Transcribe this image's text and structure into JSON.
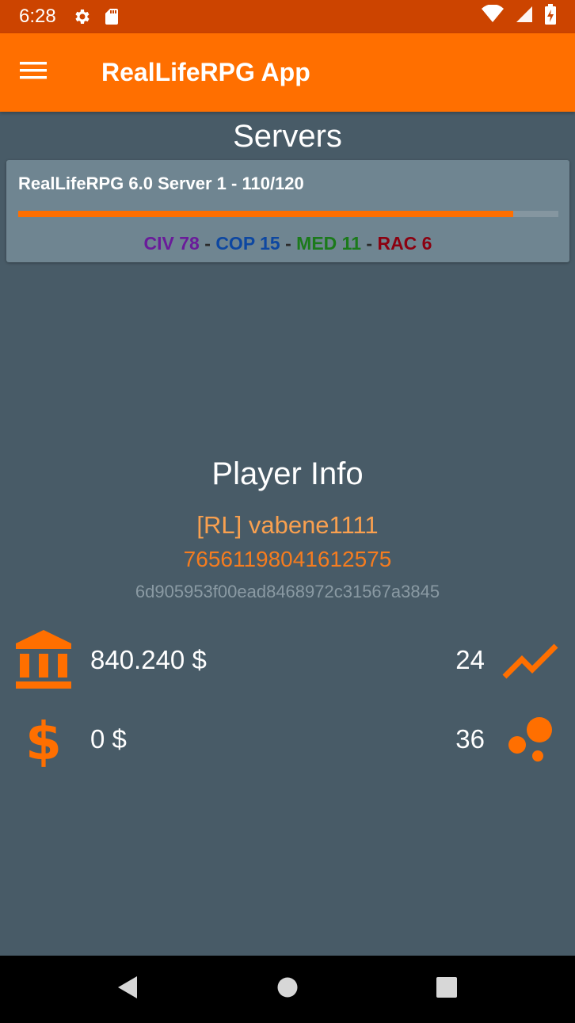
{
  "status_bar": {
    "time": "6:28",
    "icons": [
      "gear-icon",
      "sd-card-icon",
      "wifi-icon",
      "signal-icon",
      "battery-charging-icon"
    ]
  },
  "app_bar": {
    "title": "RealLifeRPG App",
    "menu_icon": "hamburger-menu-icon"
  },
  "servers": {
    "heading": "Servers",
    "items": [
      {
        "name": "RealLifeRPG 6.0 Server 1 - 110/120",
        "players": 110,
        "max_players": 120,
        "fill_fraction": 0.9167,
        "factions": {
          "civ": "CIV 78",
          "cop": "COP 15",
          "med": "MED 11",
          "rac": "RAC 6",
          "separator": " - "
        }
      }
    ]
  },
  "player": {
    "heading": "Player Info",
    "name": "[RL] vabene1111",
    "steam_id": "76561198041612575",
    "guid": "6d905953f00ead8468972c31567a3845",
    "bank": "840.240 $",
    "cash": "0 $",
    "level": "24",
    "skill_points": "36"
  },
  "colors": {
    "accent": "#ff6f00",
    "statusbar": "#cc4400",
    "background": "#485b67",
    "card": "#6f8591",
    "civ": "#6a1b9a",
    "cop": "#0d47a1",
    "med": "#1b7a1b",
    "rac": "#8b0010"
  },
  "nav": {
    "icons": [
      "back-icon",
      "home-icon",
      "recents-icon"
    ]
  }
}
